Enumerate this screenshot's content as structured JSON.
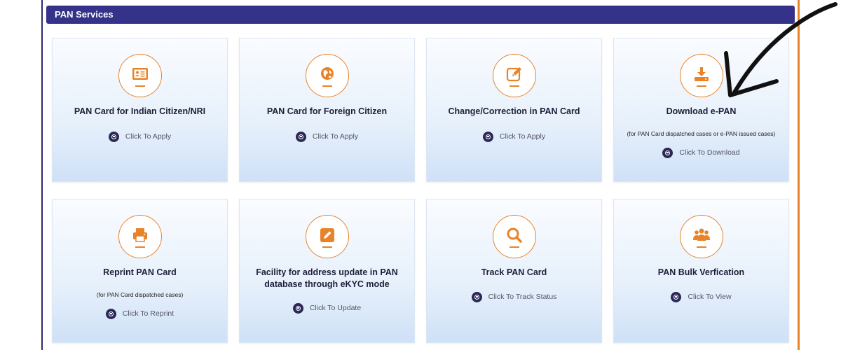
{
  "header": {
    "title": "PAN Services"
  },
  "cards": [
    {
      "title": "PAN Card for Indian Citizen/NRI",
      "note": "",
      "action": "Click To Apply",
      "icon": "id-card-icon"
    },
    {
      "title": "PAN Card for Foreign Citizen",
      "note": "",
      "action": "Click To Apply",
      "icon": "globe-icon"
    },
    {
      "title": "Change/Correction in PAN Card",
      "note": "",
      "action": "Click To Apply",
      "icon": "edit-icon"
    },
    {
      "title": "Download e-PAN",
      "note": "(for PAN Card dispatched cases or e-PAN issued cases)",
      "action": "Click To Download",
      "icon": "download-icon"
    },
    {
      "title": "Reprint PAN Card",
      "note": "(for PAN Card dispatched cases)",
      "action": "Click To Reprint",
      "icon": "printer-icon"
    },
    {
      "title": "Facility for address update in PAN database through eKYC mode",
      "note": "",
      "action": "Click To Update",
      "icon": "pencil-square-icon"
    },
    {
      "title": "Track PAN Card",
      "note": "",
      "action": "Click To Track Status",
      "icon": "search-icon"
    },
    {
      "title": "PAN Bulk Verfication",
      "note": "",
      "action": "Click To View",
      "icon": "users-icon"
    }
  ],
  "colors": {
    "header_bg": "#35328a",
    "accent": "#e8832a",
    "button_dot": "#2b2857"
  }
}
